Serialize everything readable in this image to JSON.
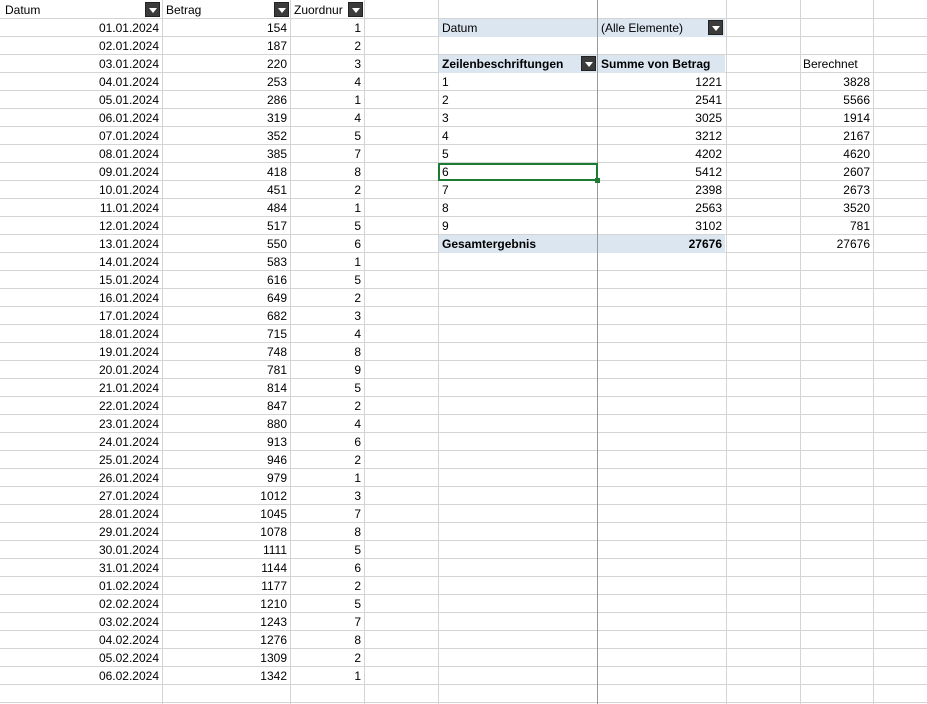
{
  "headers": {
    "datum": "Datum",
    "betrag": "Betrag",
    "zuordnung": "Zuordnur"
  },
  "rows": [
    {
      "d": "01.01.2024",
      "b": "154",
      "z": "1"
    },
    {
      "d": "02.01.2024",
      "b": "187",
      "z": "2"
    },
    {
      "d": "03.01.2024",
      "b": "220",
      "z": "3"
    },
    {
      "d": "04.01.2024",
      "b": "253",
      "z": "4"
    },
    {
      "d": "05.01.2024",
      "b": "286",
      "z": "1"
    },
    {
      "d": "06.01.2024",
      "b": "319",
      "z": "4"
    },
    {
      "d": "07.01.2024",
      "b": "352",
      "z": "5"
    },
    {
      "d": "08.01.2024",
      "b": "385",
      "z": "7"
    },
    {
      "d": "09.01.2024",
      "b": "418",
      "z": "8"
    },
    {
      "d": "10.01.2024",
      "b": "451",
      "z": "2"
    },
    {
      "d": "11.01.2024",
      "b": "484",
      "z": "1"
    },
    {
      "d": "12.01.2024",
      "b": "517",
      "z": "5"
    },
    {
      "d": "13.01.2024",
      "b": "550",
      "z": "6"
    },
    {
      "d": "14.01.2024",
      "b": "583",
      "z": "1"
    },
    {
      "d": "15.01.2024",
      "b": "616",
      "z": "5"
    },
    {
      "d": "16.01.2024",
      "b": "649",
      "z": "2"
    },
    {
      "d": "17.01.2024",
      "b": "682",
      "z": "3"
    },
    {
      "d": "18.01.2024",
      "b": "715",
      "z": "4"
    },
    {
      "d": "19.01.2024",
      "b": "748",
      "z": "8"
    },
    {
      "d": "20.01.2024",
      "b": "781",
      "z": "9"
    },
    {
      "d": "21.01.2024",
      "b": "814",
      "z": "5"
    },
    {
      "d": "22.01.2024",
      "b": "847",
      "z": "2"
    },
    {
      "d": "23.01.2024",
      "b": "880",
      "z": "4"
    },
    {
      "d": "24.01.2024",
      "b": "913",
      "z": "6"
    },
    {
      "d": "25.01.2024",
      "b": "946",
      "z": "2"
    },
    {
      "d": "26.01.2024",
      "b": "979",
      "z": "1"
    },
    {
      "d": "27.01.2024",
      "b": "1012",
      "z": "3"
    },
    {
      "d": "28.01.2024",
      "b": "1045",
      "z": "7"
    },
    {
      "d": "29.01.2024",
      "b": "1078",
      "z": "8"
    },
    {
      "d": "30.01.2024",
      "b": "1111",
      "z": "5"
    },
    {
      "d": "31.01.2024",
      "b": "1144",
      "z": "6"
    },
    {
      "d": "01.02.2024",
      "b": "1177",
      "z": "2"
    },
    {
      "d": "02.02.2024",
      "b": "1210",
      "z": "5"
    },
    {
      "d": "03.02.2024",
      "b": "1243",
      "z": "7"
    },
    {
      "d": "04.02.2024",
      "b": "1276",
      "z": "8"
    },
    {
      "d": "05.02.2024",
      "b": "1309",
      "z": "2"
    },
    {
      "d": "06.02.2024",
      "b": "1342",
      "z": "1"
    }
  ],
  "pivot": {
    "filter_label": "Datum",
    "filter_value": "(Alle Elemente)",
    "row_header": "Zeilenbeschriftungen",
    "value_header": "Summe von Betrag",
    "calc_header": "Berechnet",
    "rows": [
      {
        "k": "1",
        "sum": "1221",
        "calc": "3828"
      },
      {
        "k": "2",
        "sum": "2541",
        "calc": "5566"
      },
      {
        "k": "3",
        "sum": "3025",
        "calc": "1914"
      },
      {
        "k": "4",
        "sum": "3212",
        "calc": "2167"
      },
      {
        "k": "5",
        "sum": "4202",
        "calc": "4620"
      },
      {
        "k": "6",
        "sum": "5412",
        "calc": "2607"
      },
      {
        "k": "7",
        "sum": "2398",
        "calc": "2673"
      },
      {
        "k": "8",
        "sum": "2563",
        "calc": "3520"
      },
      {
        "k": "9",
        "sum": "3102",
        "calc": "781"
      }
    ],
    "total_label": "Gesamtergebnis",
    "total_sum": "27676",
    "total_calc": "27676"
  }
}
